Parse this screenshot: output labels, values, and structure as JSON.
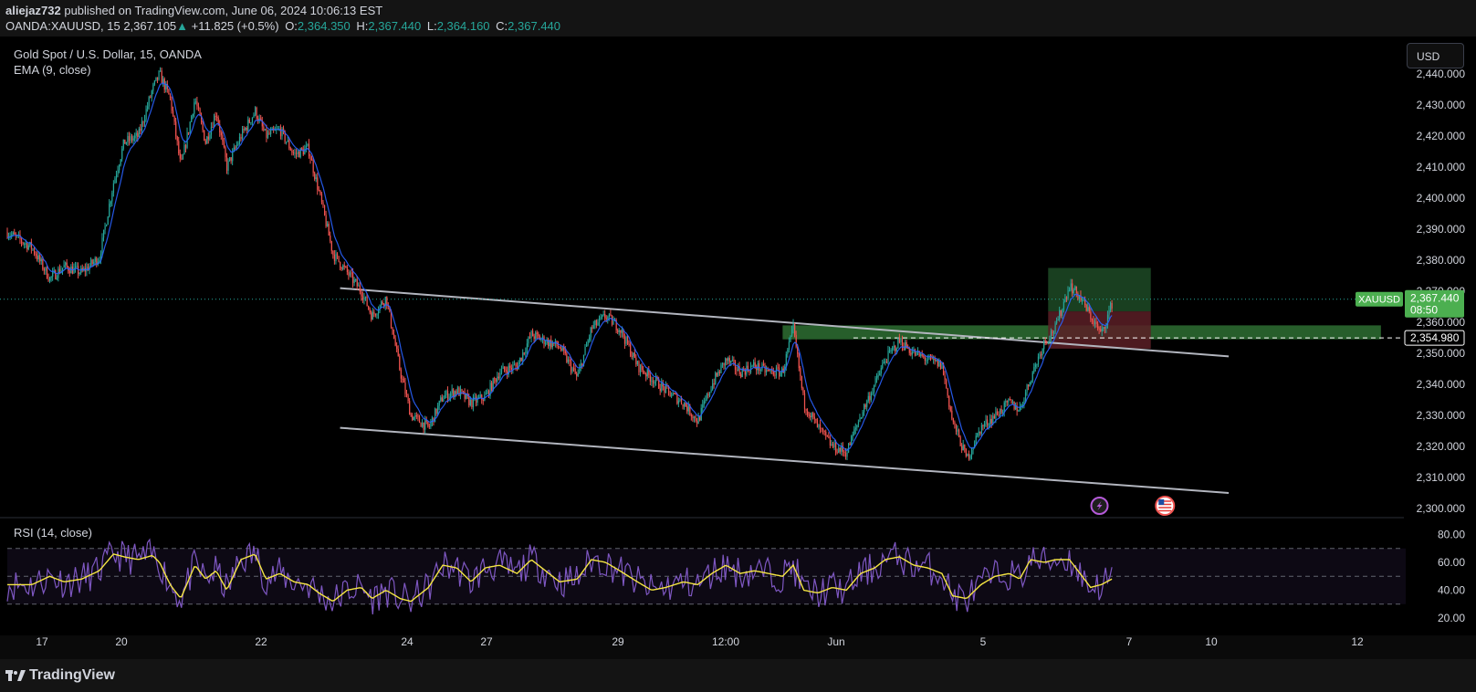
{
  "header": {
    "author": "aliejaz732",
    "published_text": "published on TradingView.com, June 06, 2024 10:06:13 EST",
    "symbol": "OANDA:XAUUSD, 15",
    "last": "2,367.105",
    "change": "+11.825 (+0.5%)",
    "open_label": "O:",
    "open": "2,364.350",
    "high_label": "H:",
    "high": "2,367.440",
    "low_label": "L:",
    "low": "2,364.160",
    "close_label": "C:",
    "close": "2,367.440"
  },
  "currency_button": "USD",
  "legend": {
    "title": "Gold Spot / U.S. Dollar, 15, OANDA",
    "ema": "EMA (9, close)",
    "rsi": "RSI (14, close)"
  },
  "footer": {
    "logo_text": "TradingView"
  },
  "colors": {
    "up": "#26a69a",
    "down": "#ef5350",
    "ema": "#2962ff",
    "rsi": "#7e57c2",
    "rsi_ma": "#f5e642",
    "symbol_badge": "#4caf50",
    "level_badge": "#ffffff"
  },
  "chart_data": [
    {
      "type": "candlestick",
      "symbol": "XAUUSD",
      "timeframe": "15",
      "y_axis": {
        "min": 2300,
        "max": 2440,
        "ticks": [
          "2,300.000",
          "2,310.000",
          "2,320.000",
          "2,330.000",
          "2,340.000",
          "2,350.000",
          "2,360.000",
          "2,370.000",
          "2,380.000",
          "2,390.000",
          "2,400.000",
          "2,410.000",
          "2,420.000",
          "2,430.000",
          "2,440.000"
        ]
      },
      "x_ticks": [
        "17",
        "20",
        "22",
        "24",
        "27",
        "29",
        "12:00",
        "Jun",
        "5",
        "7",
        "10",
        "12"
      ],
      "price_path": [
        [
          0,
          2389
        ],
        [
          0.7,
          2384
        ],
        [
          1.2,
          2374
        ],
        [
          1.6,
          2378
        ],
        [
          2.1,
          2376
        ],
        [
          2.6,
          2381
        ],
        [
          3.0,
          2405
        ],
        [
          3.3,
          2418
        ],
        [
          3.7,
          2420
        ],
        [
          4.1,
          2435
        ],
        [
          4.3,
          2440
        ],
        [
          4.6,
          2432
        ],
        [
          4.9,
          2410
        ],
        [
          5.3,
          2432
        ],
        [
          5.6,
          2418
        ],
        [
          5.9,
          2428
        ],
        [
          6.2,
          2410
        ],
        [
          6.6,
          2420
        ],
        [
          7.0,
          2428
        ],
        [
          7.3,
          2420
        ],
        [
          7.7,
          2422
        ],
        [
          8.1,
          2414
        ],
        [
          8.5,
          2416
        ],
        [
          8.8,
          2402
        ],
        [
          9.2,
          2382
        ],
        [
          9.6,
          2376
        ],
        [
          10.0,
          2370
        ],
        [
          10.3,
          2362
        ],
        [
          10.7,
          2368
        ],
        [
          11.1,
          2344
        ],
        [
          11.4,
          2330
        ],
        [
          11.9,
          2326
        ],
        [
          12.3,
          2336
        ],
        [
          12.7,
          2338
        ],
        [
          13.1,
          2334
        ],
        [
          13.5,
          2336
        ],
        [
          13.9,
          2344
        ],
        [
          14.4,
          2346
        ],
        [
          14.8,
          2356
        ],
        [
          15.2,
          2354
        ],
        [
          15.6,
          2352
        ],
        [
          16.1,
          2342
        ],
        [
          16.5,
          2358
        ],
        [
          16.9,
          2362
        ],
        [
          17.3,
          2358
        ],
        [
          17.8,
          2346
        ],
        [
          18.2,
          2342
        ],
        [
          18.6,
          2338
        ],
        [
          19.1,
          2334
        ],
        [
          19.5,
          2328
        ],
        [
          19.9,
          2340
        ],
        [
          20.3,
          2348
        ],
        [
          20.7,
          2344
        ],
        [
          21.1,
          2346
        ],
        [
          21.5,
          2344
        ],
        [
          21.9,
          2344
        ],
        [
          22.2,
          2358
        ],
        [
          22.5,
          2334
        ],
        [
          22.9,
          2326
        ],
        [
          23.3,
          2320
        ],
        [
          23.7,
          2318
        ],
        [
          24.1,
          2330
        ],
        [
          24.5,
          2340
        ],
        [
          24.8,
          2348
        ],
        [
          25.2,
          2354
        ],
        [
          25.6,
          2350
        ],
        [
          26.0,
          2348
        ],
        [
          26.4,
          2346
        ],
        [
          26.7,
          2328
        ],
        [
          27.1,
          2316
        ],
        [
          27.5,
          2326
        ],
        [
          27.9,
          2330
        ],
        [
          28.3,
          2334
        ],
        [
          28.6,
          2332
        ],
        [
          28.9,
          2342
        ],
        [
          29.3,
          2354
        ],
        [
          29.6,
          2358
        ],
        [
          30.0,
          2372
        ],
        [
          30.3,
          2368
        ],
        [
          30.6,
          2362
        ],
        [
          30.9,
          2356
        ],
        [
          31.2,
          2366
        ]
      ],
      "ema": {
        "period": 9,
        "source": "close",
        "label": "EMA (9, close)"
      },
      "current_price": {
        "value": 2367.44,
        "label": "2,367.440",
        "timer": "08:50",
        "symbol": "XAUUSD"
      },
      "horizontal_level": {
        "value": 2354.98,
        "label": "2,354.980",
        "style": "dashed"
      },
      "trendlines": [
        {
          "from": {
            "x": 9.4,
            "y": 2371
          },
          "to": {
            "x": 34.5,
            "y": 2349
          }
        },
        {
          "from": {
            "x": 9.4,
            "y": 2326
          },
          "to": {
            "x": 34.5,
            "y": 2305
          }
        }
      ],
      "zones": [
        {
          "name": "resistance-zone",
          "x": [
            21.9,
            38.8
          ],
          "y": [
            2354.5,
            2359.0
          ],
          "color": "#2e6e33"
        },
        {
          "name": "long-position-target",
          "x": [
            29.4,
            32.3
          ],
          "y": [
            2363.5,
            2377.5
          ],
          "color": "#1d4a26"
        },
        {
          "name": "long-position-stop",
          "x": [
            29.4,
            32.3
          ],
          "y": [
            2351.5,
            2363.5
          ],
          "color": "#5a1e26"
        }
      ],
      "markers": [
        {
          "type": "lightning",
          "x": 30.85,
          "y": 2300
        },
        {
          "type": "us-flag",
          "x": 32.7,
          "y": 2300
        }
      ]
    },
    {
      "type": "line",
      "title": "RSI (14, close)",
      "y_axis": {
        "min": 10,
        "max": 85,
        "ticks": [
          "20.00",
          "40.00",
          "60.00",
          "80.00"
        ]
      },
      "bands": {
        "upper": 70,
        "middle": 50,
        "lower": 30
      },
      "rsi_ma_path": [
        [
          0,
          44
        ],
        [
          0.7,
          44
        ],
        [
          1.2,
          50
        ],
        [
          1.6,
          46
        ],
        [
          2.1,
          48
        ],
        [
          2.6,
          54
        ],
        [
          3.0,
          66
        ],
        [
          3.3,
          64
        ],
        [
          3.7,
          62
        ],
        [
          4.1,
          65
        ],
        [
          4.3,
          60
        ],
        [
          4.6,
          44
        ],
        [
          4.9,
          34
        ],
        [
          5.3,
          58
        ],
        [
          5.6,
          48
        ],
        [
          5.9,
          54
        ],
        [
          6.2,
          40
        ],
        [
          6.6,
          62
        ],
        [
          7.0,
          66
        ],
        [
          7.3,
          48
        ],
        [
          7.7,
          52
        ],
        [
          8.1,
          46
        ],
        [
          8.5,
          44
        ],
        [
          8.8,
          38
        ],
        [
          9.2,
          32
        ],
        [
          9.6,
          40
        ],
        [
          10.0,
          42
        ],
        [
          10.3,
          34
        ],
        [
          10.7,
          40
        ],
        [
          11.1,
          34
        ],
        [
          11.4,
          32
        ],
        [
          11.9,
          42
        ],
        [
          12.3,
          58
        ],
        [
          12.7,
          56
        ],
        [
          13.1,
          46
        ],
        [
          13.5,
          56
        ],
        [
          13.9,
          58
        ],
        [
          14.4,
          52
        ],
        [
          14.8,
          62
        ],
        [
          15.2,
          54
        ],
        [
          15.6,
          46
        ],
        [
          16.1,
          48
        ],
        [
          16.5,
          62
        ],
        [
          16.9,
          60
        ],
        [
          17.3,
          54
        ],
        [
          17.8,
          46
        ],
        [
          18.2,
          40
        ],
        [
          18.6,
          42
        ],
        [
          19.1,
          46
        ],
        [
          19.5,
          44
        ],
        [
          19.9,
          52
        ],
        [
          20.3,
          58
        ],
        [
          20.7,
          52
        ],
        [
          21.1,
          54
        ],
        [
          21.5,
          52
        ],
        [
          21.9,
          50
        ],
        [
          22.2,
          58
        ],
        [
          22.5,
          40
        ],
        [
          22.9,
          38
        ],
        [
          23.3,
          42
        ],
        [
          23.7,
          40
        ],
        [
          24.1,
          52
        ],
        [
          24.5,
          56
        ],
        [
          24.8,
          62
        ],
        [
          25.2,
          64
        ],
        [
          25.6,
          58
        ],
        [
          26.0,
          56
        ],
        [
          26.4,
          52
        ],
        [
          26.7,
          36
        ],
        [
          27.1,
          34
        ],
        [
          27.5,
          44
        ],
        [
          27.9,
          50
        ],
        [
          28.3,
          52
        ],
        [
          28.6,
          48
        ],
        [
          28.9,
          62
        ],
        [
          29.3,
          60
        ],
        [
          29.6,
          62
        ],
        [
          30.0,
          62
        ],
        [
          30.3,
          52
        ],
        [
          30.6,
          42
        ],
        [
          30.9,
          44
        ],
        [
          31.2,
          48
        ]
      ]
    }
  ]
}
